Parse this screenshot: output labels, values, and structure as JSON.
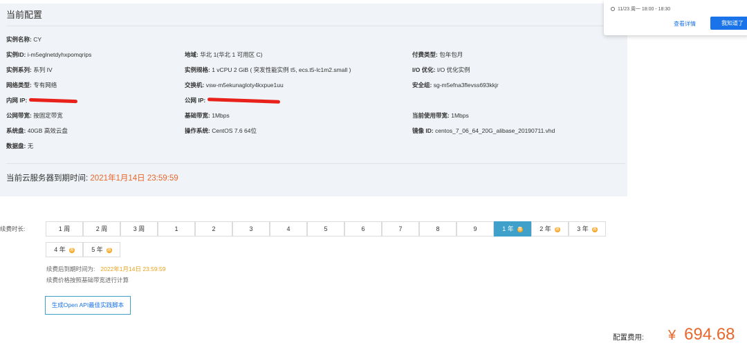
{
  "config": {
    "title": "当前配置",
    "rows": [
      {
        "label": "实例名称:",
        "value": "CY"
      },
      {
        "label": "实例ID:",
        "value": "i-m5eglnetdyhxpomqrips"
      },
      {
        "label": "地域:",
        "value": "华北 1(华北 1 可用区 C)"
      },
      {
        "label": "付费类型:",
        "value": "包年包月"
      },
      {
        "label": "实例系列:",
        "value": "系列 IV"
      },
      {
        "label": "实例规格:",
        "value": "1 vCPU 2 GiB ( 突发性能实例 t5, ecs.t5-lc1m2.small )"
      },
      {
        "label": "I/O 优化:",
        "value": "I/O 优化实例"
      },
      {
        "label": "网络类型:",
        "value": "专有网络"
      },
      {
        "label": "交换机:",
        "value": "vsw-m5ekunagloty4kxpue1uu"
      },
      {
        "label": "安全组:",
        "value": "sg-m5efna3flevss693kkjr"
      },
      {
        "label": "内网 IP:",
        "value": ""
      },
      {
        "label": "公网 IP:",
        "value": ""
      },
      {
        "label": "公网带宽:",
        "value": "按固定带宽"
      },
      {
        "label": "基础带宽:",
        "value": "1Mbps"
      },
      {
        "label": "当前使用带宽:",
        "value": "1Mbps"
      },
      {
        "label": "系统盘:",
        "value": "40GB 高效云盘"
      },
      {
        "label": "操作系统:",
        "value": "CentOS 7.6 64位"
      },
      {
        "label": "镜像 ID:",
        "value": "centos_7_06_64_20G_alibase_20190711.vhd"
      },
      {
        "label": "数据盘:",
        "value": "无"
      }
    ],
    "expire_label": "当前云服务器到期时间:",
    "expire_date": "2021年1月14日 23:59:59"
  },
  "notification": {
    "time": "11/23 周一 18:00 - 18:30",
    "detail_label": "查看详情",
    "ok_label": "我知道了"
  },
  "renew": {
    "label": "续费时长:",
    "options": [
      {
        "label": "1 周",
        "discount": false,
        "selected": false
      },
      {
        "label": "2 周",
        "discount": false,
        "selected": false
      },
      {
        "label": "3 周",
        "discount": false,
        "selected": false
      },
      {
        "label": "1",
        "discount": false,
        "selected": false
      },
      {
        "label": "2",
        "discount": false,
        "selected": false
      },
      {
        "label": "3",
        "discount": false,
        "selected": false
      },
      {
        "label": "4",
        "discount": false,
        "selected": false
      },
      {
        "label": "5",
        "discount": false,
        "selected": false
      },
      {
        "label": "6",
        "discount": false,
        "selected": false
      },
      {
        "label": "7",
        "discount": false,
        "selected": false
      },
      {
        "label": "8",
        "discount": false,
        "selected": false
      },
      {
        "label": "9",
        "discount": false,
        "selected": false
      },
      {
        "label": "1 年",
        "discount": true,
        "selected": true
      },
      {
        "label": "2 年",
        "discount": true,
        "selected": false
      },
      {
        "label": "3 年",
        "discount": true,
        "selected": false
      },
      {
        "label": "4 年",
        "discount": true,
        "selected": false
      },
      {
        "label": "5 年",
        "discount": true,
        "selected": false
      }
    ],
    "discount_glyph": "惠",
    "expire_after_label": "续费后到期时间为:",
    "expire_after_date": "2022年1月14日 23:59:59",
    "price_note": "续费价格按照基础带宽进行计算",
    "api_button": "生成Open API最佳实践脚本"
  },
  "fee": {
    "label": "配置费用:",
    "currency": "¥",
    "amount": "694.68"
  },
  "colors": {
    "accent_orange": "#e8672b",
    "selected_blue": "#3fa1c9",
    "link_blue": "#1a73e8",
    "redact_red": "#e8221b"
  }
}
